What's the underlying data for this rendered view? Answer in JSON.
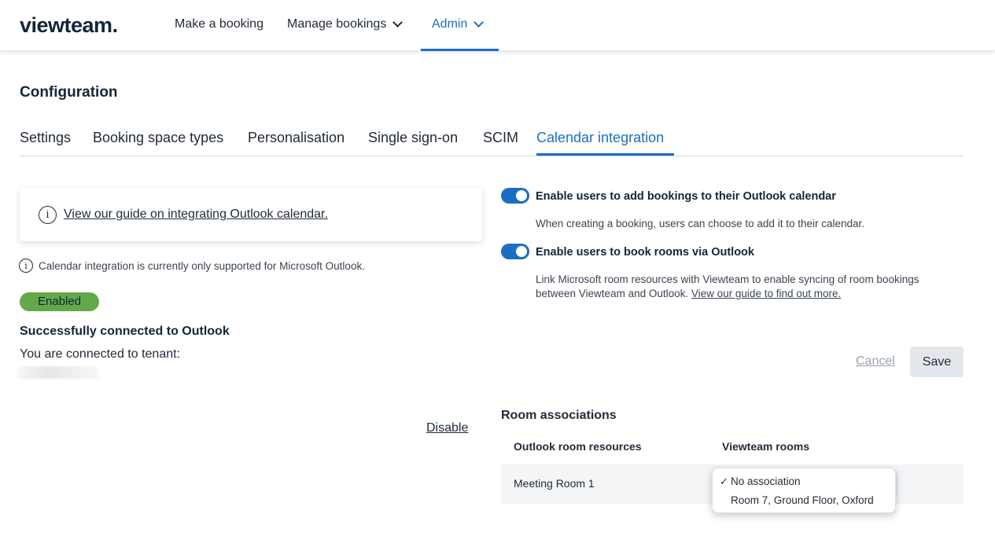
{
  "header": {
    "logo": "viewteam.",
    "nav": [
      {
        "label": "Make a booking"
      },
      {
        "label": "Manage bookings"
      },
      {
        "label": "Admin"
      }
    ]
  },
  "page": {
    "title": "Configuration"
  },
  "tabs": [
    {
      "label": "Settings"
    },
    {
      "label": "Booking space types"
    },
    {
      "label": "Personalisation"
    },
    {
      "label": "Single sign-on"
    },
    {
      "label": "SCIM"
    },
    {
      "label": "Calendar integration"
    }
  ],
  "active_tab": "Calendar integration",
  "left": {
    "guide_link": "View our guide on integrating Outlook calendar.",
    "note": "Calendar integration is currently only supported for Microsoft Outlook.",
    "status_badge": "Enabled",
    "connected_title": "Successfully connected to Outlook",
    "connected_sub": "You are connected to tenant:",
    "disable_link": "Disable"
  },
  "right": {
    "toggle1": {
      "label": "Enable users to add bookings to their Outlook calendar",
      "description": "When creating a booking, users can choose to add it to their calendar.",
      "on": true
    },
    "toggle2": {
      "label": "Enable users to book rooms via Outlook",
      "description": "Link Microsoft room resources with Viewteam to enable syncing of room bookings between Viewteam and Outlook.",
      "link": "View our guide to find out more.",
      "on": true
    },
    "cancel_label": "Cancel",
    "save_label": "Save"
  },
  "rooms": {
    "title": "Room associations",
    "columns": [
      "Outlook room resources",
      "Viewteam rooms"
    ],
    "rows": [
      {
        "resource": "Meeting Room 1"
      }
    ],
    "dropdown": {
      "options": [
        "No association",
        "Room 7, Ground Floor, Oxford"
      ],
      "selected": "No association",
      "check": "✓"
    }
  },
  "colors": {
    "accent": "#1b6fc2",
    "enabled_badge": "#63a84a",
    "text_dark": "#12263a"
  }
}
